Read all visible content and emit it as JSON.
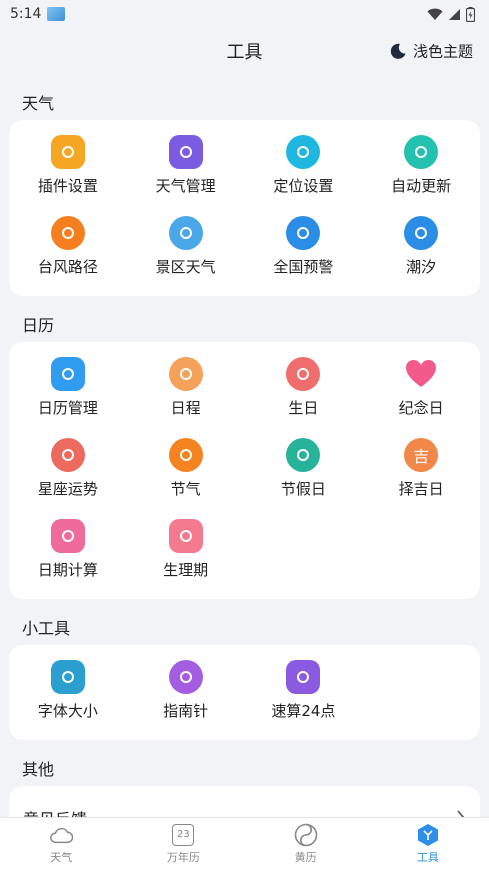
{
  "status": {
    "time": "5:14"
  },
  "header": {
    "title": "工具",
    "theme_label": "浅色主题"
  },
  "sections": {
    "weather": {
      "title": "天气",
      "items": [
        {
          "label": "插件设置",
          "icon": "puzzle-icon",
          "color": "#f5a623"
        },
        {
          "label": "天气管理",
          "icon": "list-manage-icon",
          "color": "#7b5ce0"
        },
        {
          "label": "定位设置",
          "icon": "location-pin-icon",
          "color": "#1fb7e0"
        },
        {
          "label": "自动更新",
          "icon": "refresh-icon",
          "color": "#22c1b0"
        },
        {
          "label": "台风路径",
          "icon": "typhoon-icon",
          "color": "#f57f1e"
        },
        {
          "label": "景区天气",
          "icon": "scenic-weather-icon",
          "color": "#4aa8e8"
        },
        {
          "label": "全国预警",
          "icon": "warning-shield-icon",
          "color": "#2a8de6"
        },
        {
          "label": "潮汐",
          "icon": "tide-icon",
          "color": "#2b8de6"
        }
      ]
    },
    "calendar": {
      "title": "日历",
      "items": [
        {
          "label": "日历管理",
          "icon": "calendar-manage-icon",
          "color": "#2f9cf0"
        },
        {
          "label": "日程",
          "icon": "schedule-icon",
          "color": "#f4a25a"
        },
        {
          "label": "生日",
          "icon": "birthday-cake-icon",
          "color": "#ef6d6d"
        },
        {
          "label": "纪念日",
          "icon": "heart-icon",
          "color": "#f25a8a"
        },
        {
          "label": "星座运势",
          "icon": "aries-icon",
          "color": "#ec6a5e"
        },
        {
          "label": "节气",
          "icon": "solar-term-icon",
          "color": "#f5831f"
        },
        {
          "label": "节假日",
          "icon": "holiday-balloon-icon",
          "color": "#27b39a"
        },
        {
          "label": "择吉日",
          "icon": "lucky-day-icon",
          "color": "#f2874a",
          "glyph": "吉"
        },
        {
          "label": "日期计算",
          "icon": "date-calculator-icon",
          "color": "#f06b9a"
        },
        {
          "label": "生理期",
          "icon": "period-tracker-icon",
          "color": "#f47a8f"
        }
      ]
    },
    "tools": {
      "title": "小工具",
      "items": [
        {
          "label": "字体大小",
          "icon": "font-size-icon",
          "color": "#2a9fd0"
        },
        {
          "label": "指南针",
          "icon": "compass-icon",
          "color": "#a35de0"
        },
        {
          "label": "速算24点",
          "icon": "game-controller-icon",
          "color": "#8a5ae0"
        }
      ]
    },
    "other": {
      "title": "其他",
      "items": [
        {
          "label": "意见反馈"
        }
      ]
    }
  },
  "tabbar": [
    {
      "label": "天气",
      "icon": "cloud-icon",
      "active": false
    },
    {
      "label": "万年历",
      "icon": "calendar-23-icon",
      "active": false,
      "glyph": "23"
    },
    {
      "label": "黄历",
      "icon": "yin-yang-icon",
      "active": false
    },
    {
      "label": "工具",
      "icon": "tools-icon",
      "active": true
    }
  ]
}
